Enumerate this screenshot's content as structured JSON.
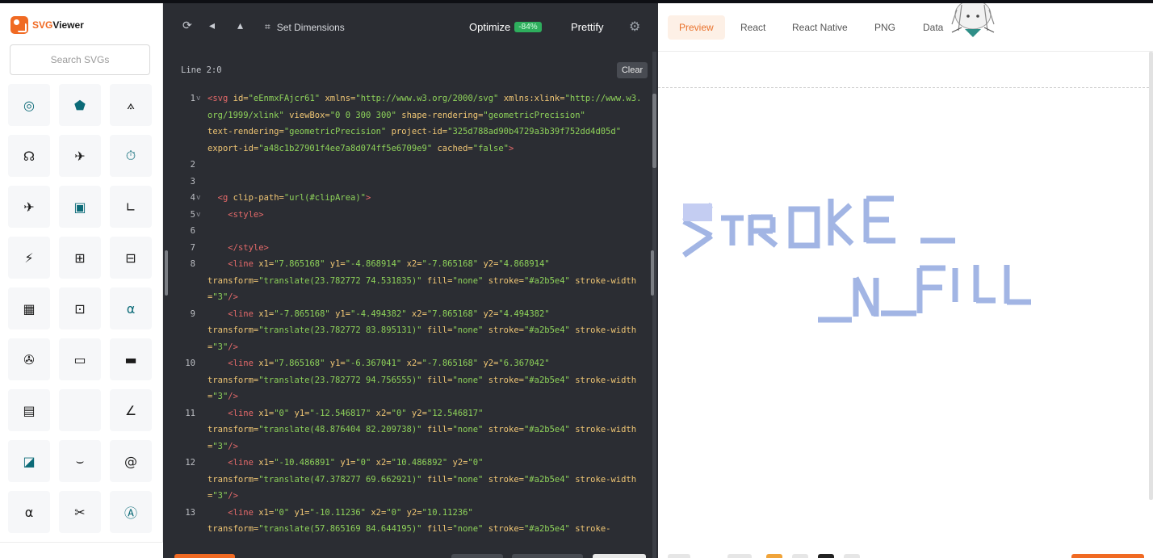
{
  "app": {
    "logo_svg": "SVG",
    "logo_viewer": "Viewer"
  },
  "sidebar": {
    "search_placeholder": "Search SVGs",
    "icons": [
      {
        "name": "at-circle-icon",
        "glyph": "◎"
      },
      {
        "name": "house-tag-icon",
        "glyph": "⬟"
      },
      {
        "name": "compass-drafting-icon",
        "glyph": "⟑"
      },
      {
        "name": "headset-icon",
        "glyph": "☊"
      },
      {
        "name": "airplane-right-icon",
        "glyph": "✈"
      },
      {
        "name": "stopwatch-icon",
        "glyph": "⏱"
      },
      {
        "name": "airplane-left-icon",
        "glyph": "✈"
      },
      {
        "name": "framed-picture-icon",
        "glyph": "▣"
      },
      {
        "name": "angle-right-icon",
        "glyph": "∟"
      },
      {
        "name": "airplane-slash-icon",
        "glyph": "⚡"
      },
      {
        "name": "bed-plus-icon",
        "glyph": "⊞"
      },
      {
        "name": "bed-icon",
        "glyph": "⊟"
      },
      {
        "name": "building-icon",
        "glyph": "▦"
      },
      {
        "name": "bed-person-icon",
        "glyph": "⊡"
      },
      {
        "name": "alpha-box-icon",
        "glyph": "α"
      },
      {
        "name": "airplane-down-icon",
        "glyph": "✇"
      },
      {
        "name": "air-conditioner-icon",
        "glyph": "▭"
      },
      {
        "name": "air-conditioner-2-icon",
        "glyph": "▬"
      },
      {
        "name": "document-check-icon",
        "glyph": "▤"
      },
      {
        "name": "apple-icon",
        "glyph": ""
      },
      {
        "name": "angle-icon",
        "glyph": "∠"
      },
      {
        "name": "image-box-icon",
        "glyph": "◪"
      },
      {
        "name": "amazon-smile-icon",
        "glyph": "⌣"
      },
      {
        "name": "at-sign-icon",
        "glyph": "@"
      },
      {
        "name": "alpha-icon",
        "glyph": "α"
      },
      {
        "name": "airplane-off-icon",
        "glyph": "✂"
      },
      {
        "name": "a-circle-icon",
        "glyph": "Ⓐ"
      }
    ]
  },
  "editor": {
    "toolbar": {
      "set_dimensions": "Set Dimensions",
      "optimize": "Optimize",
      "optimize_badge": "-84%",
      "prettify": "Prettify"
    },
    "status": "Line 2:0",
    "clear": "Clear",
    "lines": [
      {
        "n": "1",
        "fold": true,
        "html": "<span class='tag'>&lt;svg</span> <span class='attr'>id=</span><span class='val'>\"eEnmxFAjcr61\"</span> <span class='attr'>xmlns=</span><span class='val'>\"http://www.w3.org/2000/svg\"</span> <span class='attr'>xmlns:xlink=</span><span class='val'>\"http://​www.w3.org/1999/xlink\"</span> <span class='attr'>viewBox=</span><span class='val'>\"0 0 300 300\"</span> <span class='attr'>shape-rendering=</span><span class='val'>\"geometricPrecision\"</span>\n<span class='attr'>text-rendering=</span><span class='val'>\"geometricPrecision\"</span> <span class='attr'>project-id=</span><span class='val'>\"325d788ad90b4729a3b39f752dd4d05d\"</span>\n<span class='attr'>export-id=</span><span class='val'>\"a48c1b27901f4ee7a8d074ff5e6709e9\"</span> <span class='attr'>cached=</span><span class='val'>\"false\"</span><span class='tag'>&gt;</span>"
      },
      {
        "n": "2",
        "fold": false,
        "html": ""
      },
      {
        "n": "3",
        "fold": false,
        "html": ""
      },
      {
        "n": "4",
        "fold": true,
        "html": "  <span class='tag'>&lt;g</span> <span class='attr'>clip-path=</span><span class='val'>\"url(#clipArea)\"</span><span class='tag'>&gt;</span>"
      },
      {
        "n": "5",
        "fold": true,
        "html": "    <span class='tag'>&lt;style&gt;</span>"
      },
      {
        "n": "6",
        "fold": false,
        "html": ""
      },
      {
        "n": "7",
        "fold": false,
        "html": "    <span class='tag'>&lt;/style&gt;</span>"
      },
      {
        "n": "8",
        "fold": false,
        "html": "    <span class='tag'>&lt;line</span> <span class='attr'>x1=</span><span class='val'>\"7.865168\"</span> <span class='attr'>y1=</span><span class='val'>\"-4.868914\"</span> <span class='attr'>x2=</span><span class='val'>\"-7.865168\"</span> <span class='attr'>y2=</span><span class='val'>\"4.868914\"</span>\n<span class='attr'>transform=</span><span class='val'>\"translate(23.782772 74.531835)\"</span> <span class='attr'>fill=</span><span class='val'>\"none\"</span> <span class='attr'>stroke=</span><span class='val'>\"#a2b5e4\"</span> <span class='attr'>stroke-​width=</span><span class='val'>\"3\"</span><span class='tag'>/&gt;</span>"
      },
      {
        "n": "9",
        "fold": false,
        "html": "    <span class='tag'>&lt;line</span> <span class='attr'>x1=</span><span class='val'>\"-7.865168\"</span> <span class='attr'>y1=</span><span class='val'>\"-4.494382\"</span> <span class='attr'>x2=</span><span class='val'>\"7.865168\"</span> <span class='attr'>y2=</span><span class='val'>\"4.494382\"</span>\n<span class='attr'>transform=</span><span class='val'>\"translate(23.782772 83.895131)\"</span> <span class='attr'>fill=</span><span class='val'>\"none\"</span> <span class='attr'>stroke=</span><span class='val'>\"#a2b5e4\"</span> <span class='attr'>stroke-​width=</span><span class='val'>\"3\"</span><span class='tag'>/&gt;</span>"
      },
      {
        "n": "10",
        "fold": false,
        "html": "    <span class='tag'>&lt;line</span> <span class='attr'>x1=</span><span class='val'>\"7.865168\"</span> <span class='attr'>y1=</span><span class='val'>\"-6.367041\"</span> <span class='attr'>x2=</span><span class='val'>\"-7.865168\"</span> <span class='attr'>y2=</span><span class='val'>\"6.367042\"</span>\n<span class='attr'>transform=</span><span class='val'>\"translate(23.782772 94.756555)\"</span> <span class='attr'>fill=</span><span class='val'>\"none\"</span> <span class='attr'>stroke=</span><span class='val'>\"#a2b5e4\"</span> <span class='attr'>stroke-​width=</span><span class='val'>\"3\"</span><span class='tag'>/&gt;</span>"
      },
      {
        "n": "11",
        "fold": false,
        "html": "    <span class='tag'>&lt;line</span> <span class='attr'>x1=</span><span class='val'>\"0\"</span> <span class='attr'>y1=</span><span class='val'>\"-12.546817\"</span> <span class='attr'>x2=</span><span class='val'>\"0\"</span> <span class='attr'>y2=</span><span class='val'>\"12.546817\"</span>\n<span class='attr'>transform=</span><span class='val'>\"translate(48.876404 82.209738)\"</span> <span class='attr'>fill=</span><span class='val'>\"none\"</span> <span class='attr'>stroke=</span><span class='val'>\"#a2b5e4\"</span> <span class='attr'>stroke-​width=</span><span class='val'>\"3\"</span><span class='tag'>/&gt;</span>"
      },
      {
        "n": "12",
        "fold": false,
        "html": "    <span class='tag'>&lt;line</span> <span class='attr'>x1=</span><span class='val'>\"-10.486891\"</span> <span class='attr'>y1=</span><span class='val'>\"0\"</span> <span class='attr'>x2=</span><span class='val'>\"10.486892\"</span> <span class='attr'>y2=</span><span class='val'>\"0\"</span>\n<span class='attr'>transform=</span><span class='val'>\"translate(47.378277 69.662921)\"</span> <span class='attr'>fill=</span><span class='val'>\"none\"</span> <span class='attr'>stroke=</span><span class='val'>\"#a2b5e4\"</span> <span class='attr'>stroke-​width=</span><span class='val'>\"3\"</span><span class='tag'>/&gt;</span>"
      },
      {
        "n": "13",
        "fold": false,
        "html": "    <span class='tag'>&lt;line</span> <span class='attr'>x1=</span><span class='val'>\"0\"</span> <span class='attr'>y1=</span><span class='val'>\"-10.11236\"</span> <span class='attr'>x2=</span><span class='val'>\"0\"</span> <span class='attr'>y2=</span><span class='val'>\"10.11236\"</span>\n<span class='attr'>transform=</span><span class='val'>\"translate(57.865169 84.644195)\"</span> <span class='attr'>fill=</span><span class='val'>\"none\"</span> <span class='attr'>stroke=</span><span class='val'>\"#a2b5e4\"</span> <span class='attr'>stroke-</span>"
      }
    ]
  },
  "preview": {
    "tabs": [
      {
        "id": "preview",
        "label": "Preview",
        "active": true
      },
      {
        "id": "react",
        "label": "React",
        "active": false
      },
      {
        "id": "react-native",
        "label": "React Native",
        "active": false
      },
      {
        "id": "png",
        "label": "PNG",
        "active": false
      },
      {
        "id": "data",
        "label": "Data",
        "active": false
      }
    ]
  },
  "colors": {
    "accent": "#f06a23",
    "editor_bg": "#2b2d33",
    "stroke": "#a2b5e4",
    "badge": "#2eae5d"
  }
}
